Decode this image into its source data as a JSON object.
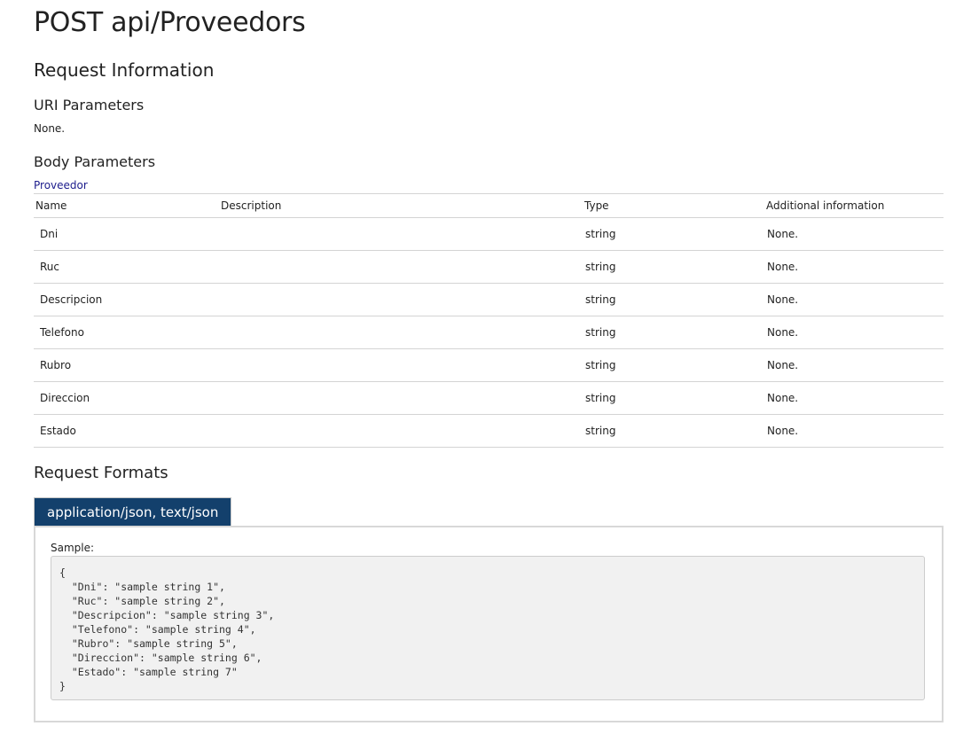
{
  "title": "POST api/Proveedors",
  "request_information": {
    "heading": "Request Information",
    "uri_parameters": {
      "heading": "URI Parameters",
      "value": "None."
    },
    "body_parameters": {
      "heading": "Body Parameters",
      "type_link": "Proveedor",
      "columns": [
        "Name",
        "Description",
        "Type",
        "Additional information"
      ],
      "rows": [
        {
          "name": "Dni",
          "description": "",
          "type": "string",
          "info": "None."
        },
        {
          "name": "Ruc",
          "description": "",
          "type": "string",
          "info": "None."
        },
        {
          "name": "Descripcion",
          "description": "",
          "type": "string",
          "info": "None."
        },
        {
          "name": "Telefono",
          "description": "",
          "type": "string",
          "info": "None."
        },
        {
          "name": "Rubro",
          "description": "",
          "type": "string",
          "info": "None."
        },
        {
          "name": "Direccion",
          "description": "",
          "type": "string",
          "info": "None."
        },
        {
          "name": "Estado",
          "description": "",
          "type": "string",
          "info": "None."
        }
      ]
    }
  },
  "request_formats": {
    "heading": "Request Formats",
    "tab_label": "application/json, text/json",
    "sample_label": "Sample:",
    "sample_code": "{\n  \"Dni\": \"sample string 1\",\n  \"Ruc\": \"sample string 2\",\n  \"Descripcion\": \"sample string 3\",\n  \"Telefono\": \"sample string 4\",\n  \"Rubro\": \"sample string 5\",\n  \"Direccion\": \"sample string 6\",\n  \"Estado\": \"sample string 7\"\n}"
  },
  "colors": {
    "tab_background": "#13406c",
    "link": "#1c1c8c",
    "sample_background": "#f1f1f1",
    "table_border": "#d4d4d4"
  }
}
